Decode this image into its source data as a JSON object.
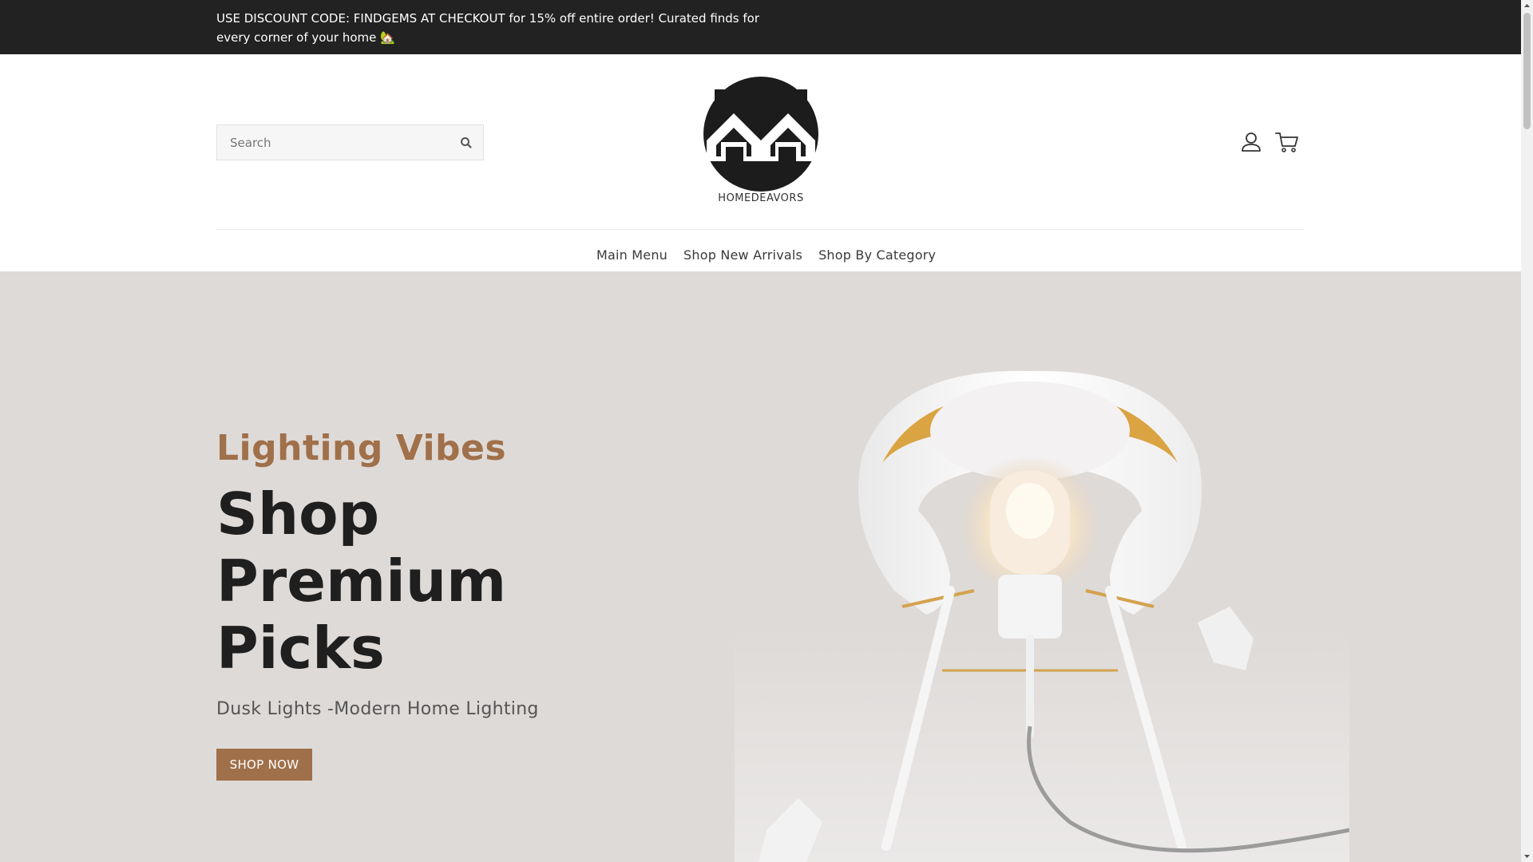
{
  "announcement": {
    "text": "USE DISCOUNT CODE: FINDGEMS AT CHECKOUT for 15% off entire order! Curated finds for every corner of your home 🏡"
  },
  "header": {
    "search_placeholder": "Search",
    "logo_text": "HOMEDEAVORS",
    "search_icon": "search-icon",
    "account_icon": "user-icon",
    "cart_icon": "cart-icon"
  },
  "nav": {
    "items": [
      "Main Menu",
      "Shop New Arrivals",
      "Shop By Category"
    ]
  },
  "hero": {
    "subheading": "Lighting Vibes",
    "heading": "Shop Premium Picks",
    "text": "Dusk Lights -Modern Home Lighting",
    "button_label": "SHOP NOW",
    "image": "white-table-lamp"
  },
  "colors": {
    "accent": "#a0704a",
    "announcement_bg": "#222222",
    "hero_bg": "#dedad8"
  }
}
